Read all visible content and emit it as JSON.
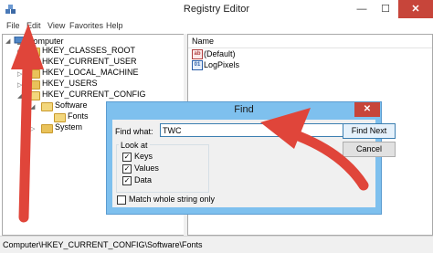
{
  "window": {
    "title": "Registry Editor",
    "minimize_glyph": "—",
    "maximize_glyph": "☐",
    "close_glyph": "✕",
    "app_icon": "registry-cubes-icon"
  },
  "menu": [
    "File",
    "Edit",
    "View",
    "Favorites",
    "Help"
  ],
  "tree": {
    "root": "Computer",
    "items": [
      {
        "label": "HKEY_CLASSES_ROOT"
      },
      {
        "label": "HKEY_CURRENT_USER"
      },
      {
        "label": "HKEY_LOCAL_MACHINE"
      },
      {
        "label": "HKEY_USERS"
      },
      {
        "label": "HKEY_CURRENT_CONFIG"
      },
      {
        "label": "Software"
      },
      {
        "label": "Fonts"
      },
      {
        "label": "System"
      }
    ]
  },
  "list": {
    "column_name": "Name",
    "rows": [
      {
        "name": "(Default)",
        "icon": "ab"
      },
      {
        "name": "LogPixels",
        "icon": "01"
      }
    ]
  },
  "status": {
    "path": "Computer\\HKEY_CURRENT_CONFIG\\Software\\Fonts"
  },
  "find": {
    "title": "Find",
    "close_glyph": "✕",
    "find_what_label": "Find what:",
    "find_what_value": "TWC",
    "find_next": "Find Next",
    "cancel": "Cancel",
    "look_at_label": "Look at",
    "keys": "Keys",
    "values": "Values",
    "data": "Data",
    "match_whole": "Match whole string only",
    "check_mark": "✓"
  },
  "colors": {
    "arrow": "#e0453a",
    "dialog_frame": "#7ec0ee",
    "close_button": "#c7453a"
  }
}
